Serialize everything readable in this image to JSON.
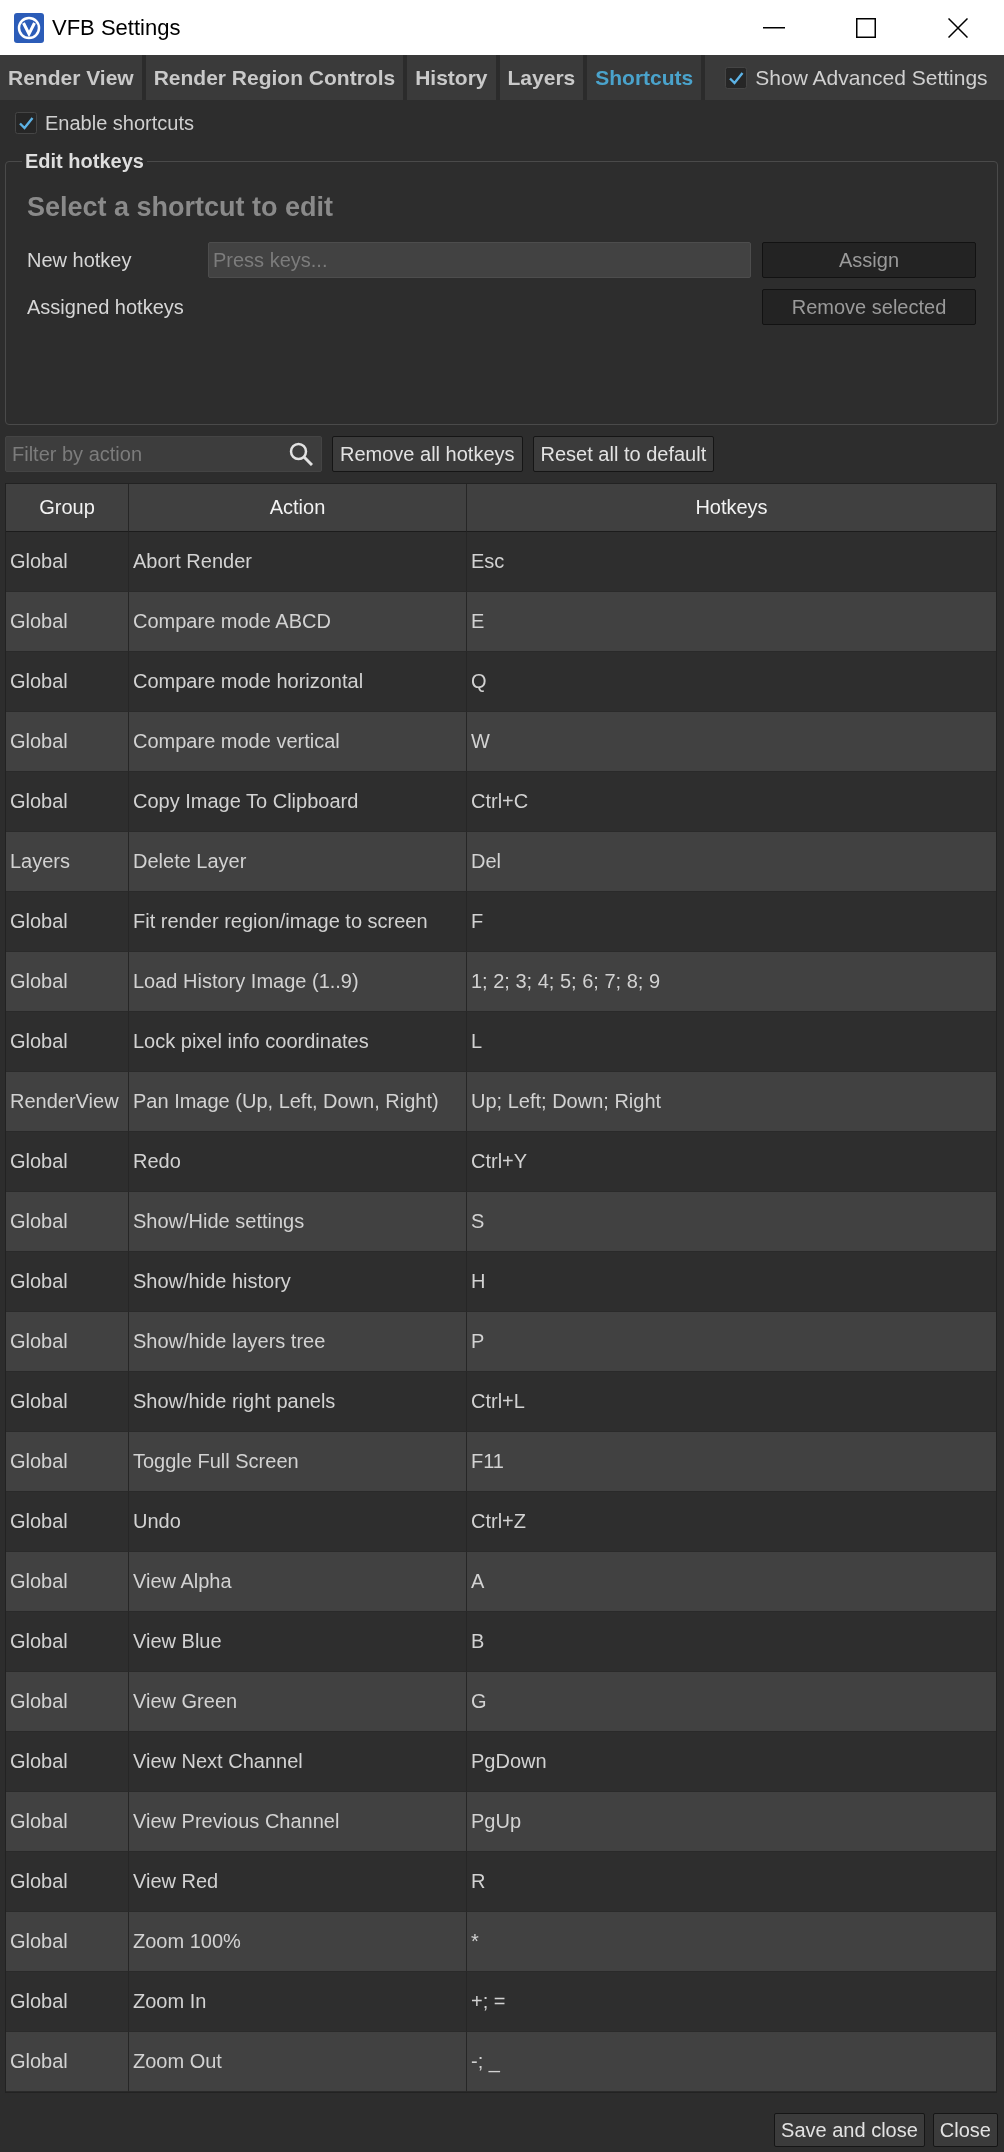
{
  "window": {
    "title": "VFB Settings"
  },
  "tabs": [
    {
      "label": "Render View",
      "selected": false
    },
    {
      "label": "Render Region Controls",
      "selected": false
    },
    {
      "label": "History",
      "selected": false
    },
    {
      "label": "Layers",
      "selected": false
    },
    {
      "label": "Shortcuts",
      "selected": true
    }
  ],
  "show_advanced_settings": {
    "label": "Show Advanced Settings",
    "checked": true
  },
  "enable_shortcuts": {
    "label": "Enable shortcuts",
    "checked": true
  },
  "edit_hotkeys": {
    "title": "Edit hotkeys",
    "heading": "Select a shortcut to edit",
    "new_hotkey": {
      "label": "New hotkey",
      "placeholder": "Press keys..."
    },
    "assigned_hotkeys": {
      "label": "Assigned hotkeys"
    },
    "buttons": [
      {
        "label": "Assign",
        "disabled": true
      },
      {
        "label": "Remove selected",
        "disabled": true
      }
    ]
  },
  "filter": {
    "placeholder": "Filter by action"
  },
  "toolbar_buttons": [
    "Remove all hotkeys",
    "Reset all to default"
  ],
  "table": {
    "columns": [
      "Group",
      "Action",
      "Hotkeys"
    ],
    "rows": [
      {
        "group": "Global",
        "action": "Abort Render",
        "hotkeys": "Esc"
      },
      {
        "group": "Global",
        "action": "Compare mode ABCD",
        "hotkeys": "E"
      },
      {
        "group": "Global",
        "action": "Compare mode horizontal",
        "hotkeys": "Q"
      },
      {
        "group": "Global",
        "action": "Compare mode vertical",
        "hotkeys": "W"
      },
      {
        "group": "Global",
        "action": "Copy Image To Clipboard",
        "hotkeys": "Ctrl+C"
      },
      {
        "group": "Layers",
        "action": "Delete Layer",
        "hotkeys": "Del"
      },
      {
        "group": "Global",
        "action": "Fit render region/image to screen",
        "hotkeys": "F"
      },
      {
        "group": "Global",
        "action": "Load History Image (1..9)",
        "hotkeys": "1; 2; 3; 4; 5; 6; 7; 8; 9"
      },
      {
        "group": "Global",
        "action": "Lock pixel info coordinates",
        "hotkeys": "L"
      },
      {
        "group": "RenderView",
        "action": "Pan Image (Up, Left, Down, Right)",
        "hotkeys": "Up; Left; Down; Right"
      },
      {
        "group": "Global",
        "action": "Redo",
        "hotkeys": "Ctrl+Y"
      },
      {
        "group": "Global",
        "action": "Show/Hide settings",
        "hotkeys": "S"
      },
      {
        "group": "Global",
        "action": "Show/hide history",
        "hotkeys": "H"
      },
      {
        "group": "Global",
        "action": "Show/hide layers tree",
        "hotkeys": "P"
      },
      {
        "group": "Global",
        "action": "Show/hide right panels",
        "hotkeys": "Ctrl+L"
      },
      {
        "group": "Global",
        "action": "Toggle Full Screen",
        "hotkeys": "F11"
      },
      {
        "group": "Global",
        "action": "Undo",
        "hotkeys": "Ctrl+Z"
      },
      {
        "group": "Global",
        "action": "View Alpha",
        "hotkeys": "A"
      },
      {
        "group": "Global",
        "action": "View Blue",
        "hotkeys": "B"
      },
      {
        "group": "Global",
        "action": "View Green",
        "hotkeys": "G"
      },
      {
        "group": "Global",
        "action": "View Next Channel",
        "hotkeys": "PgDown"
      },
      {
        "group": "Global",
        "action": "View Previous Channel",
        "hotkeys": "PgUp"
      },
      {
        "group": "Global",
        "action": "View Red",
        "hotkeys": "R"
      },
      {
        "group": "Global",
        "action": "Zoom 100%",
        "hotkeys": "*"
      },
      {
        "group": "Global",
        "action": "Zoom In",
        "hotkeys": "+; ="
      },
      {
        "group": "Global",
        "action": "Zoom Out",
        "hotkeys": "-; _"
      }
    ]
  },
  "footer_buttons": [
    "Save and close",
    "Close"
  ]
}
